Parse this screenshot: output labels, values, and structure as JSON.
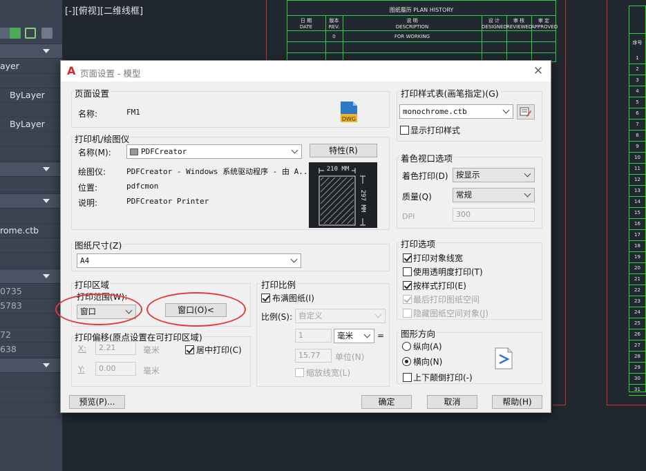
{
  "palette": {
    "rows": [
      "ayer",
      "ByLayer",
      "ByLayer",
      "rome.ctb",
      "0735",
      "5783",
      "72",
      "638"
    ]
  },
  "canvas": {
    "viewport_label": "[-][俯视][二维线框]",
    "plan_history": {
      "title": "图纸履历 PLAN HISTORY",
      "col_date": "日 期\nDATE",
      "col_rev": "版本\nREV.",
      "col_desc": "说 明\nDESCRIPTION",
      "col_designed": "设 计\nDESIGNED",
      "col_reviewed": "审 核\nREVIEWED",
      "col_approved": "审 定\nAPPROVED",
      "row_rev": "0",
      "row_desc": "FOR WORKING"
    },
    "seq_header": "序号",
    "seq_numbers": [
      "1",
      "2",
      "3",
      "4",
      "5",
      "6",
      "7",
      "8",
      "9",
      "10",
      "11",
      "12",
      "13",
      "14",
      "15",
      "16",
      "17",
      "18",
      "19",
      "20",
      "21",
      "22",
      "23",
      "24",
      "25",
      "26",
      "27",
      "28",
      "29",
      "30",
      "31"
    ]
  },
  "dialog": {
    "title": "页面设置 - 模型",
    "page_setup": {
      "group": "页面设置",
      "name_label": "名称:",
      "name_value": "FM1"
    },
    "printer": {
      "group": "打印机/绘图仪",
      "name_label": "名称(M):",
      "name_value": "PDFCreator",
      "properties_button": "特性(R)",
      "plotter_label": "绘图仪:",
      "plotter_value": "PDFCreator - Windows 系统驱动程序 - 由 A...",
      "location_label": "位置:",
      "location_value": "pdfcmon",
      "description_label": "说明:",
      "description_value": "PDFCreator Printer",
      "preview_width": "210 MM",
      "preview_height": "297 MM"
    },
    "paper_size": {
      "group": "图纸尺寸(Z)",
      "value": "A4"
    },
    "plot_area": {
      "group": "打印区域",
      "range_label": "打印范围(W):",
      "range_value": "窗口",
      "window_button": "窗口(O)<"
    },
    "plot_offset": {
      "group": "打印偏移(原点设置在可打印区域)",
      "x_label": "X:",
      "x_value": "2.21",
      "x_unit": "毫米",
      "y_label": "Y:",
      "y_value": "0.00",
      "y_unit": "毫米",
      "center_label": "居中打印(C)"
    },
    "plot_scale": {
      "group": "打印比例",
      "fit_label": "布满图纸(I)",
      "scale_label": "比例(S):",
      "scale_value": "自定义",
      "value1": "1",
      "unit_value": "毫米",
      "equals": "=",
      "value2": "15.77",
      "unit2": "单位(N)",
      "scale_lineweights": "缩放线宽(L)"
    },
    "plot_style_table": {
      "group": "打印样式表(画笔指定)(G)",
      "value": "monochrome.ctb",
      "display_label": "显示打印样式"
    },
    "shaded_viewport": {
      "group": "着色视口选项",
      "shade_label": "着色打印(D)",
      "shade_value": "按显示",
      "quality_label": "质量(Q)",
      "quality_value": "常规",
      "dpi_label": "DPI",
      "dpi_value": "300"
    },
    "plot_options": {
      "group": "打印选项",
      "items": [
        {
          "label": "打印对象线宽",
          "checked": true,
          "disabled": false
        },
        {
          "label": "使用透明度打印(T)",
          "checked": false,
          "disabled": false
        },
        {
          "label": "按样式打印(E)",
          "checked": true,
          "disabled": false
        },
        {
          "label": "最后打印图纸空间",
          "checked": true,
          "disabled": true
        },
        {
          "label": "隐藏图纸空间对象(J)",
          "checked": false,
          "disabled": true
        }
      ]
    },
    "orientation": {
      "group": "图形方向",
      "portrait": "纵向(A)",
      "landscape": "横向(N)",
      "upside_down": "上下颠倒打印(-)"
    },
    "buttons": {
      "preview": "预览(P)...",
      "ok": "确定",
      "cancel": "取消",
      "help": "帮助(H)"
    },
    "colors": {
      "highlight": "#e23a3a",
      "logo": "#d12b2b"
    }
  }
}
